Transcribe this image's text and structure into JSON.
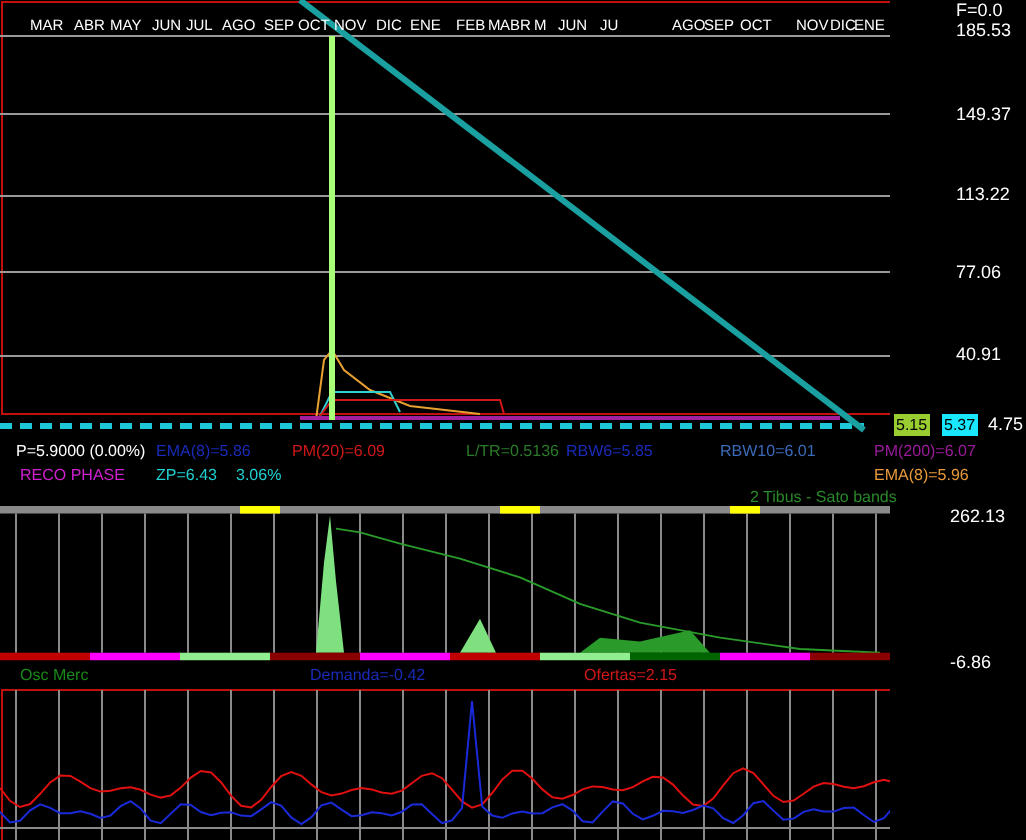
{
  "price_panel": {
    "months": [
      "MAR",
      "ABR",
      "MAY",
      "JUN",
      "JUL",
      "AGO",
      "SEP",
      "OCT",
      "NOV",
      "DIC",
      "ENE",
      "FEB",
      "M",
      "ABR",
      "M",
      "JUN",
      "JU",
      "AGO",
      "SEP",
      "OCT",
      "NOV",
      "DIC",
      "ENE"
    ],
    "axis_labels": [
      "F=0.0",
      "185.53",
      "149.37",
      "113.22",
      "77.06",
      "40.91",
      "4.75"
    ],
    "last_boxes": [
      {
        "text": "5.15",
        "color": "#9acd32"
      },
      {
        "text": "5.37",
        "color": "#19e6ff"
      }
    ]
  },
  "indicators": [
    {
      "text": "P=5.9000 (0.00%)",
      "color": "#ffffff"
    },
    {
      "text": "EMA(8)=5.86",
      "color": "#1a2ab8"
    },
    {
      "text": "PM(20)=6.09",
      "color": "#d01818"
    },
    {
      "text": "L/TR=0.5136",
      "color": "#2a7a2a"
    },
    {
      "text": "RBW6=5.85",
      "color": "#1a2ab8"
    },
    {
      "text": "RBW10=6.01",
      "color": "#3a6ab8"
    },
    {
      "text": "PM(200)=6.07",
      "color": "#9a1a9a"
    }
  ],
  "phase_row": [
    {
      "text": "RECO PHASE",
      "color": "#d020d0"
    },
    {
      "text": "ZP=6.43",
      "color": "#20d0d0"
    },
    {
      "text": "3.06%",
      "color": "#20d0d0"
    },
    {
      "text": "EMA(8)=5.96",
      "color": "#e89a3a"
    }
  ],
  "bands_title": {
    "text": "2 Tibus - Sato bands",
    "color": "#2a8a2a"
  },
  "oscillator_panel": {
    "axis_labels": [
      "262.13",
      "-6.86"
    ]
  },
  "oscillator_legend": [
    {
      "text": "Osc Merc",
      "color": "#1a8a1a"
    },
    {
      "text": "Demanda=-0.42",
      "color": "#1a2ab8"
    },
    {
      "text": "Ofertas=2.15",
      "color": "#d01818"
    }
  ]
}
